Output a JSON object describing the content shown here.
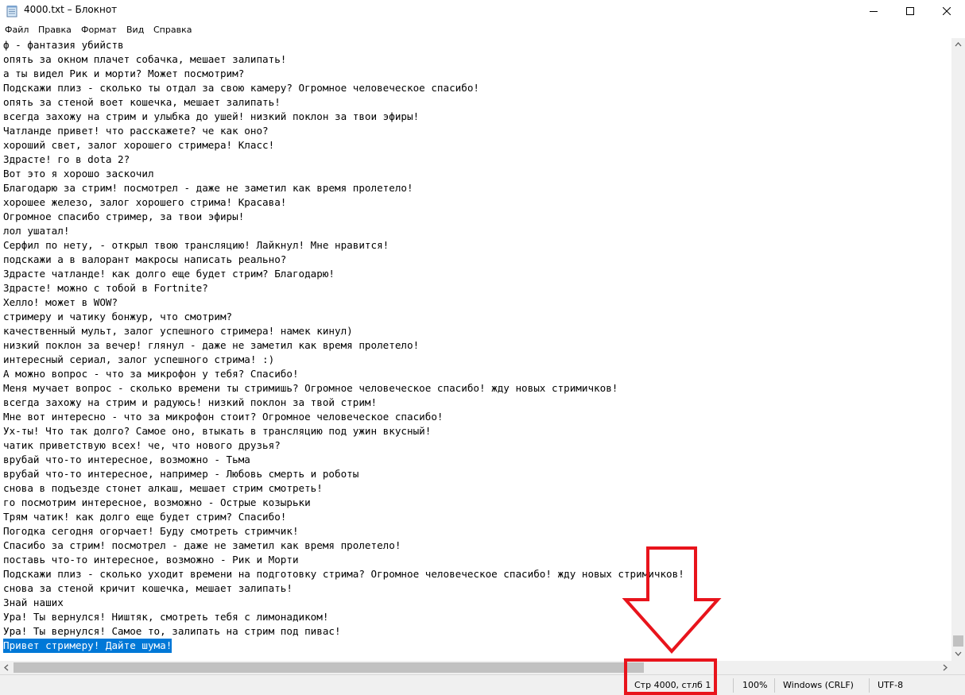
{
  "window": {
    "title": "4000.txt – Блокнот",
    "icon": "notepad-icon",
    "controls": [
      "minimize-icon",
      "maximize-icon",
      "close-icon"
    ]
  },
  "menu": {
    "items": [
      "Файл",
      "Правка",
      "Формат",
      "Вид",
      "Справка"
    ]
  },
  "document": {
    "lines": [
      "ф - фантазия убийств",
      "опять за окном плачет собачка, мешает залипать!",
      "а ты видел Рик и морти? Может посмотрим?",
      "Подскажи плиз - сколько ты отдал за свою камеру? Огромное человеческое спасибо!",
      "опять за стеной воет кошечка, мешает залипать!",
      "всегда захожу на стрим и улыбка до ушей! низкий поклон за твои эфиры!",
      "Чатланде привет! что расскажете? че как оно?",
      "хороший свет, залог хорошего стримера! Класс!",
      "Здрасте! го в dota 2?",
      "Вот это я хорошо заскочил",
      "Благодарю за стрим! посмотрел - даже не заметил как время пролетело!",
      "хорошее железо, залог хорошего стрима! Красава!",
      "Огромное спасибо стример, за твои эфиры!",
      "лол ушатал!",
      "Серфил по нету, - открыл твою трансляцию! Лайкнул! Мне нравится!",
      "подскажи а в валорант макросы написать реально?",
      "Здрасте чатланде! как долго еще будет стрим? Благодарю!",
      "Здрасте! можно с тобой в Fortnite?",
      "Хелло! может в WOW?",
      "стримеру и чатику бонжур, что смотрим?",
      "качественный мульт, залог успешного стримера! намек кинул)",
      "низкий поклон за вечер! глянул - даже не заметил как время пролетело!",
      "интересный сериал, залог успешного стрима! :)",
      "А можно вопрос - что за микрофон у тебя? Спасибо!",
      "Меня мучает вопрос - сколько времени ты стримишь? Огромное человеческое спасибо! жду новых стримичков!",
      "всегда захожу на стрим и радуюсь! низкий поклон за твой стрим!",
      "Мне вот интересно - что за микрофон стоит? Огромное человеческое спасибо!",
      "Ух-ты! Что так долго? Самое оно, втыкать в трансляцию под ужин вкусный!",
      "чатик приветствую всех! че, что нового друзья?",
      "врубай что-то интересное, возможно - Тьма",
      "врубай что-то интересное, например - Любовь смерть и роботы",
      "снова в подъезде стонет алкаш, мешает стрим смотреть!",
      "го посмотрим интересное, возможно - Острые козырьки",
      "Трям чатик! как долго еще будет стрим? Спасибо!",
      "Погодка сегодня огорчает! Буду смотреть стримчик!",
      "Спасибо за стрим! посмотрел - даже не заметил как время пролетело!",
      "поставь что-то интересное, возможно - Рик и Морти",
      "Подскажи плиз - сколько уходит времени на подготовку стрима? Огромное человеческое спасибо! жду новых стримичков!",
      "снова за стеной кричит кошечка, мешает залипать!",
      "Знай наших",
      "Ура! Ты вернулся! Ништяк, смотреть тебя с лимонадиком!",
      "Ура! Ты вернулся! Самое то, залипать на стрим под пивас!",
      "Привет стримеру! Дайте шума!"
    ],
    "selected_line_index": 42
  },
  "statusbar": {
    "position": "Стр 4000, стлб 1",
    "zoom": "100%",
    "line_endings": "Windows (CRLF)",
    "encoding": "UTF-8"
  },
  "annotation": {
    "type": "red-arrow-and-box",
    "target": "statusbar-position",
    "color": "#e8141c"
  },
  "colors": {
    "selection": "#0078d7",
    "chrome": "#f0f0f0"
  }
}
